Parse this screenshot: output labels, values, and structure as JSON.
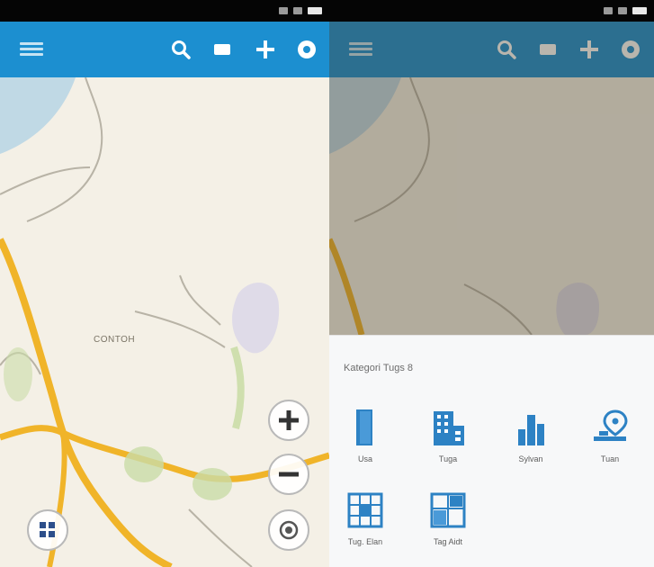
{
  "colors": {
    "appbar": "#1c8fd0",
    "road_primary": "#f0b429",
    "water": "#a9cfe4",
    "park": "#c9dca8",
    "land": "#f4f0e6",
    "category_icon": "#2d82c4"
  },
  "left_screen": {
    "appbar": {
      "menu_icon": "menu-icon",
      "actions": [
        "search-icon",
        "layers-icon",
        "add-icon",
        "settings-icon"
      ]
    },
    "map": {
      "place_label": "CONTOH"
    },
    "controls": {
      "zoom_in_icon": "plus-icon",
      "zoom_out_icon": "minus-icon",
      "locate_icon": "locate-icon",
      "grid_icon": "grid-icon"
    }
  },
  "right_screen": {
    "sheet": {
      "title": "Kategori Tugs 8",
      "categories": [
        {
          "label": "Usa",
          "icon": "door-icon"
        },
        {
          "label": "Tuga",
          "icon": "building-icon"
        },
        {
          "label": "Sylvan",
          "icon": "city-icon"
        },
        {
          "label": "Tuan",
          "icon": "map-pin-icon"
        },
        {
          "label": "Tug. Elan",
          "icon": "grid-map-icon"
        },
        {
          "label": "Tag Aidt",
          "icon": "floor-plan-icon"
        }
      ]
    }
  }
}
